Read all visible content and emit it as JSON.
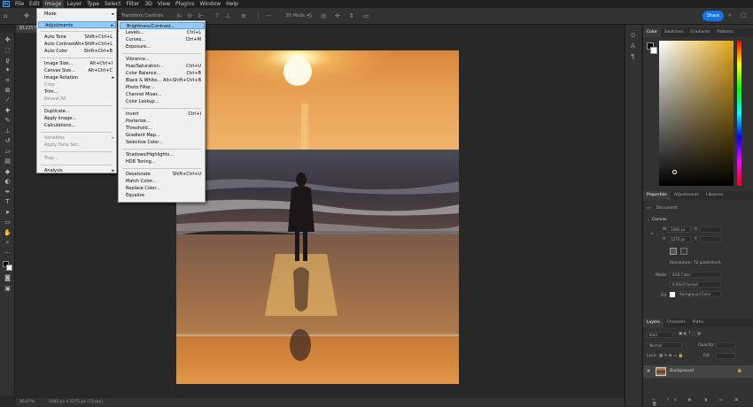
{
  "menubar": {
    "app_badge": "Ps",
    "items": [
      "File",
      "Edit",
      "Image",
      "Layer",
      "Type",
      "Select",
      "Filter",
      "3D",
      "View",
      "Plugins",
      "Window",
      "Help"
    ]
  },
  "options": {
    "transform_label": "Transform Controls",
    "mode3d_label": "3D Mode:",
    "share_label": "Share"
  },
  "doc": {
    "tab_label": "812357",
    "zoom": "66.67%",
    "dimensions": "1080 px x 1275 px (72 ppi)"
  },
  "image_menu": {
    "items": [
      {
        "label": "Mode",
        "shortcut": "",
        "submenu": true,
        "disabled": false,
        "highlight": false
      },
      {
        "label": "Adjustments",
        "shortcut": "",
        "submenu": true,
        "disabled": false,
        "highlight": true
      },
      {
        "label": "Auto Tone",
        "shortcut": "Shift+Ctrl+L",
        "submenu": false,
        "disabled": false,
        "highlight": false
      },
      {
        "label": "Auto Contrast",
        "shortcut": "Alt+Shift+Ctrl+L",
        "submenu": false,
        "disabled": false,
        "highlight": false
      },
      {
        "label": "Auto Color",
        "shortcut": "Shift+Ctrl+B",
        "submenu": false,
        "disabled": false,
        "highlight": false
      },
      {
        "label": "Image Size...",
        "shortcut": "Alt+Ctrl+I",
        "submenu": false,
        "disabled": false,
        "highlight": false
      },
      {
        "label": "Canvas Size...",
        "shortcut": "Alt+Ctrl+C",
        "submenu": false,
        "disabled": false,
        "highlight": false
      },
      {
        "label": "Image Rotation",
        "shortcut": "",
        "submenu": true,
        "disabled": false,
        "highlight": false
      },
      {
        "label": "Crop",
        "shortcut": "",
        "submenu": false,
        "disabled": true,
        "highlight": false
      },
      {
        "label": "Trim...",
        "shortcut": "",
        "submenu": false,
        "disabled": false,
        "highlight": false
      },
      {
        "label": "Reveal All",
        "shortcut": "",
        "submenu": false,
        "disabled": true,
        "highlight": false
      },
      {
        "label": "Duplicate...",
        "shortcut": "",
        "submenu": false,
        "disabled": false,
        "highlight": false
      },
      {
        "label": "Apply Image...",
        "shortcut": "",
        "submenu": false,
        "disabled": false,
        "highlight": false
      },
      {
        "label": "Calculations...",
        "shortcut": "",
        "submenu": false,
        "disabled": false,
        "highlight": false
      },
      {
        "label": "Variables",
        "shortcut": "",
        "submenu": true,
        "disabled": true,
        "highlight": false
      },
      {
        "label": "Apply Data Set...",
        "shortcut": "",
        "submenu": false,
        "disabled": true,
        "highlight": false
      },
      {
        "label": "Trap...",
        "shortcut": "",
        "submenu": false,
        "disabled": true,
        "highlight": false
      },
      {
        "label": "Analysis",
        "shortcut": "",
        "submenu": true,
        "disabled": false,
        "highlight": false
      }
    ]
  },
  "adjustments_menu": {
    "items": [
      {
        "label": "Brightness/Contrast...",
        "shortcut": "",
        "highlight": true
      },
      {
        "label": "Levels...",
        "shortcut": "Ctrl+L",
        "highlight": false
      },
      {
        "label": "Curves...",
        "shortcut": "Ctrl+M",
        "highlight": false
      },
      {
        "label": "Exposure...",
        "shortcut": "",
        "highlight": false
      },
      {
        "label": "Vibrance...",
        "shortcut": "",
        "highlight": false
      },
      {
        "label": "Hue/Saturation...",
        "shortcut": "Ctrl+U",
        "highlight": false
      },
      {
        "label": "Color Balance...",
        "shortcut": "Ctrl+B",
        "highlight": false
      },
      {
        "label": "Black & White...",
        "shortcut": "Alt+Shift+Ctrl+B",
        "highlight": false
      },
      {
        "label": "Photo Filter...",
        "shortcut": "",
        "highlight": false
      },
      {
        "label": "Channel Mixer...",
        "shortcut": "",
        "highlight": false
      },
      {
        "label": "Color Lookup...",
        "shortcut": "",
        "highlight": false
      },
      {
        "label": "Invert",
        "shortcut": "Ctrl+I",
        "highlight": false
      },
      {
        "label": "Posterize...",
        "shortcut": "",
        "highlight": false
      },
      {
        "label": "Threshold...",
        "shortcut": "",
        "highlight": false
      },
      {
        "label": "Gradient Map...",
        "shortcut": "",
        "highlight": false
      },
      {
        "label": "Selective Color...",
        "shortcut": "",
        "highlight": false
      },
      {
        "label": "Shadows/Highlights...",
        "shortcut": "",
        "highlight": false
      },
      {
        "label": "HDR Toning...",
        "shortcut": "",
        "highlight": false
      },
      {
        "label": "Desaturate",
        "shortcut": "Shift+Ctrl+U",
        "highlight": false
      },
      {
        "label": "Match Color...",
        "shortcut": "",
        "highlight": false
      },
      {
        "label": "Replace Color...",
        "shortcut": "",
        "highlight": false
      },
      {
        "label": "Equalize",
        "shortcut": "",
        "highlight": false
      }
    ]
  },
  "color_panel": {
    "tabs": [
      "Color",
      "Swatches",
      "Gradients",
      "Patterns"
    ]
  },
  "properties_panel": {
    "tabs": [
      "Properties",
      "Adjustments",
      "Libraries"
    ],
    "doc_label": "Document",
    "canvas_label": "Canvas",
    "w_label": "W",
    "w_value": "1080 px",
    "h_label": "H",
    "h_value": "1275 px",
    "x_label": "X",
    "y_label": "Y",
    "resolution": "Resolution: 72 pixels/inch",
    "mode_label": "Mode",
    "mode_value": "RGB Color",
    "depth_value": "8 Bits/Channel",
    "fill_label": "Fill",
    "fill_value": "Background Color"
  },
  "layers_panel": {
    "tabs": [
      "Layers",
      "Channels",
      "Paths"
    ],
    "search_placeholder": "Kind",
    "blend_mode": "Normal",
    "opacity_label": "Opacity:",
    "lock_label": "Lock:",
    "fill_label": "Fill:",
    "layer_name": "Background"
  },
  "colors": {
    "accent": "#1473e6",
    "menu_highlight": "#91c9f7",
    "foreground": "#000000",
    "background": "#ffffff"
  }
}
